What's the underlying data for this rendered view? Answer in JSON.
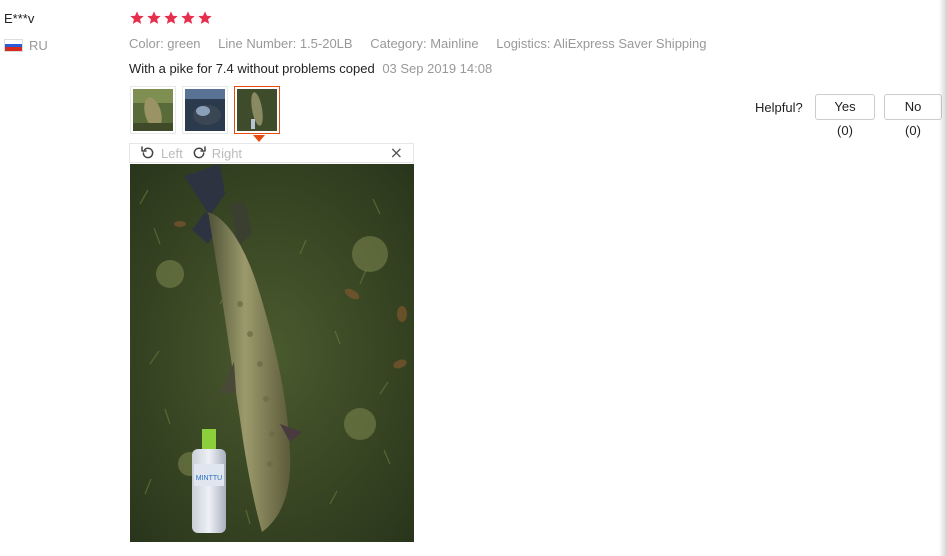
{
  "review": {
    "user_name": "E***v",
    "country": "RU",
    "rating": 5,
    "attributes": {
      "color": "Color: green",
      "line_number": "Line Number: 1.5-20LB",
      "category": "Category: Mainline",
      "logistics": "Logistics: AliExpress Saver Shipping"
    },
    "text": "With a pike for 7.4 without problems coped",
    "date": "03 Sep 2019 14:08",
    "thumbnails": [
      "fish-photo-1",
      "fish-photo-2",
      "fish-photo-3"
    ],
    "active_thumbnail": 3
  },
  "viewer": {
    "rotate_left": "Left",
    "rotate_right": "Right",
    "close": "×",
    "bottle_label": "MINTTU"
  },
  "helpful": {
    "label": "Helpful?",
    "yes": "Yes (0)",
    "no": "No (0)"
  },
  "colors": {
    "star": "#e62e4d",
    "accent": "#e64b0f"
  }
}
